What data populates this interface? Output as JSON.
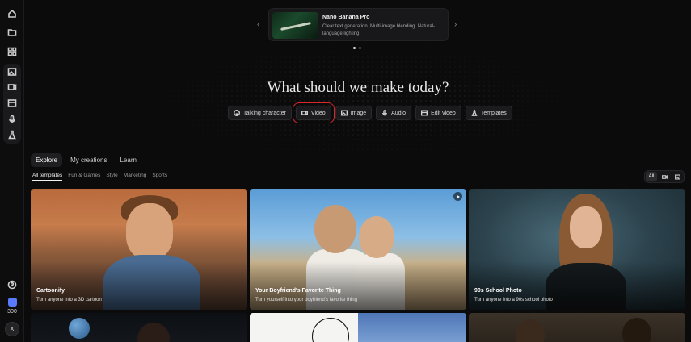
{
  "carousel": {
    "title": "Nano Banana Pro",
    "description": "Clear text generation. Multi-image blending. Natural-language lighting.",
    "prev_arrow": "‹",
    "next_arrow": "›"
  },
  "heading": "What should we make today?",
  "chips": [
    {
      "label": "Talking character",
      "icon": "smiley-icon"
    },
    {
      "label": "Video",
      "icon": "video-icon",
      "selected": true
    },
    {
      "label": "Image",
      "icon": "image-icon"
    },
    {
      "label": "Audio",
      "icon": "microphone-icon"
    },
    {
      "label": "Edit video",
      "icon": "edit-video-icon"
    },
    {
      "label": "Templates",
      "icon": "flask-icon"
    }
  ],
  "tabs": [
    "Explore",
    "My creations",
    "Learn"
  ],
  "subtabs": [
    "All templates",
    "Fun & Games",
    "Style",
    "Marketing",
    "Sports"
  ],
  "filter": {
    "all_label": "All"
  },
  "sidebar": {
    "credits": "300",
    "avatar_initial": "X"
  },
  "cards": [
    {
      "title": "Cartoonify",
      "subtitle": "Turn anyone into a 3D cartoon"
    },
    {
      "title": "Your Boyfriend's Favorite Thing",
      "subtitle": "Turn yourself into your boyfriend's favorite thing"
    },
    {
      "title": "90s School Photo",
      "subtitle": "Turn anyone into a 90s school photo"
    }
  ],
  "colors": {
    "accent": "#5b7bff",
    "selection_outline": "#d9262b",
    "background": "#0b0b0c"
  }
}
